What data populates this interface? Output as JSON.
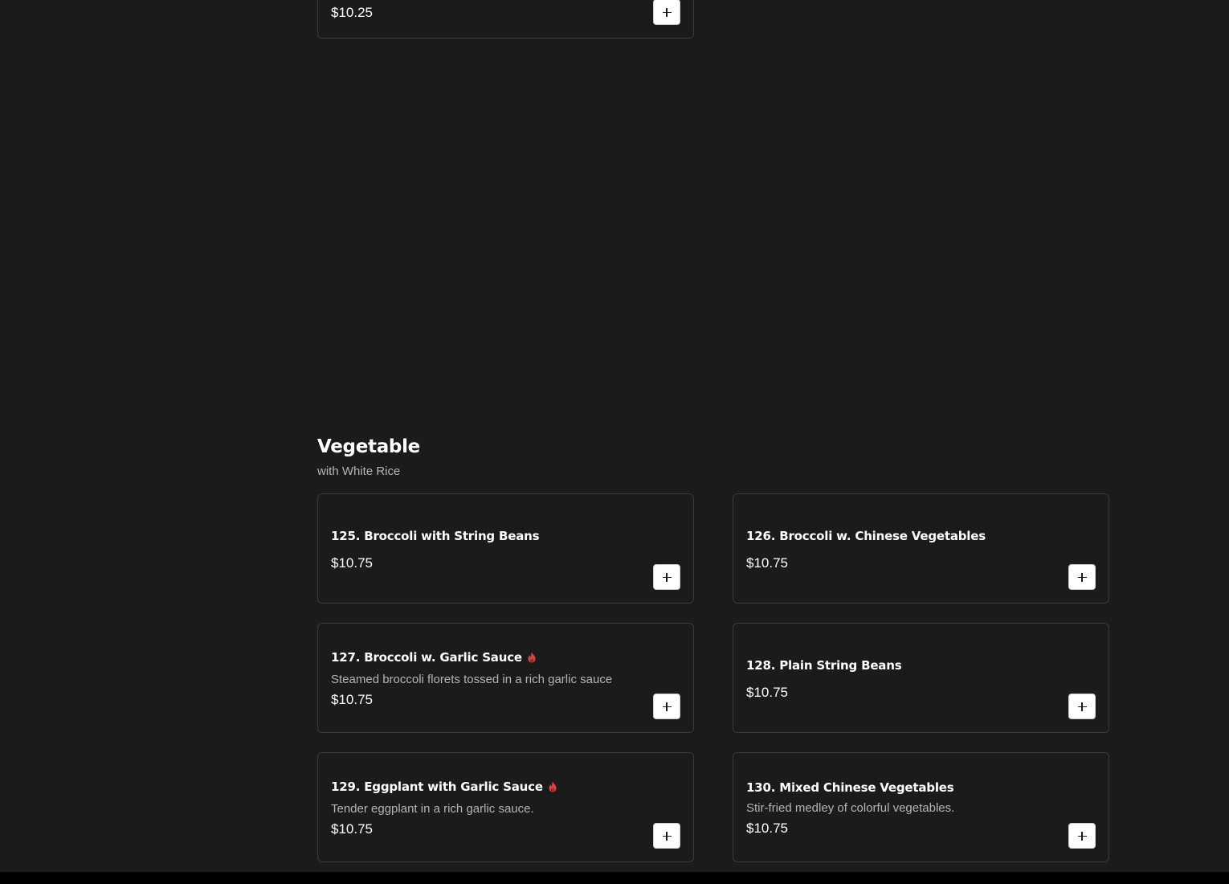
{
  "previous_section": {
    "last_item_price": "$10.25"
  },
  "section": {
    "title": "Vegetable",
    "subtitle": "with White Rice"
  },
  "items": [
    {
      "title": "125. Broccoli with String Beans",
      "description": "",
      "price": "$10.75",
      "spicy": false
    },
    {
      "title": "126. Broccoli w. Chinese Vegetables",
      "description": "",
      "price": "$10.75",
      "spicy": false
    },
    {
      "title": "127. Broccoli w. Garlic Sauce",
      "description": "Steamed broccoli florets tossed in a rich garlic sauce",
      "price": "$10.75",
      "spicy": true
    },
    {
      "title": "128. Plain String Beans",
      "description": "",
      "price": "$10.75",
      "spicy": false
    },
    {
      "title": "129. Eggplant with Garlic Sauce",
      "description": "Tender eggplant in a rich garlic sauce.",
      "price": "$10.75",
      "spicy": true
    },
    {
      "title": "130. Mixed Chinese Vegetables",
      "description": "Stir-fried medley of colorful vegetables.",
      "price": "$10.75",
      "spicy": false
    }
  ],
  "icons": {
    "add": "plus-icon",
    "spicy": "flame-icon"
  },
  "colors": {
    "background": "#1b1b1b",
    "card_border": "#3a3a3a",
    "spicy": "#e0413c",
    "muted_text": "#b4b4b4"
  }
}
